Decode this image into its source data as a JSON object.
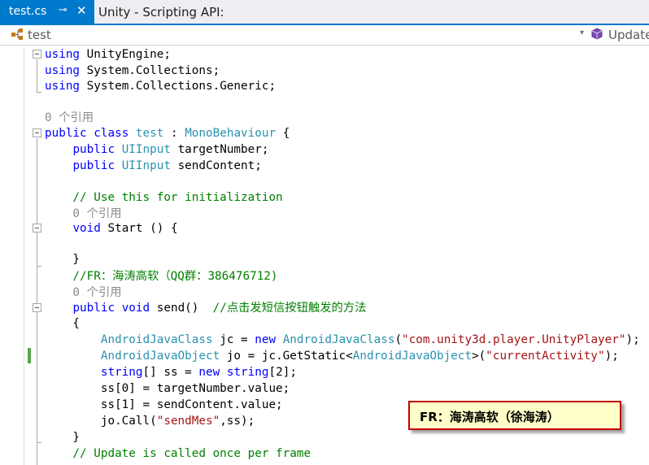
{
  "tabs": {
    "active": {
      "label": "test.cs",
      "pin_glyph": "⊸",
      "close_glyph": "✕"
    },
    "inactive": {
      "label": "Unity - Scripting API:"
    }
  },
  "navbar": {
    "left": {
      "label": "test",
      "icon": "class-icon",
      "dropdown_glyph": "▾"
    },
    "right": {
      "label": "Update",
      "icon": "method-cube-icon"
    }
  },
  "code": {
    "l1": [
      "using",
      " UnityEngine;"
    ],
    "l2": [
      "using",
      " System.Collections;"
    ],
    "l3": [
      "using",
      " System.Collections.Generic;"
    ],
    "lens1": "0 个引用",
    "l5": [
      "public",
      " ",
      "class",
      " ",
      "test",
      " : ",
      "MonoBehaviour",
      " {"
    ],
    "l6": [
      "    ",
      "public",
      " ",
      "UIInput",
      " targetNumber;"
    ],
    "l7": [
      "    ",
      "public",
      " ",
      "UIInput",
      " sendContent;"
    ],
    "l9": "    // Use this for initialization",
    "lens2": "    0 个引用",
    "l10": [
      "    ",
      "void",
      " Start () {"
    ],
    "l12": "    }",
    "l13": "    //FR：海涛高软（QQ群：386476712)",
    "lens3": "    0 个引用",
    "l14": [
      "    ",
      "public",
      " ",
      "void",
      " send()  ",
      "//点击发短信按钮触发的方法"
    ],
    "l15": "    {",
    "l16": [
      "        ",
      "AndroidJavaClass",
      " jc = ",
      "new",
      " ",
      "AndroidJavaClass",
      "(",
      "\"com.unity3d.player.UnityPlayer\"",
      ");"
    ],
    "l17": [
      "        ",
      "AndroidJavaObject",
      " jo = jc.GetStatic<",
      "AndroidJavaObject",
      ">(",
      "\"currentActivity\"",
      ");"
    ],
    "l18": [
      "        ",
      "string",
      "[] ss = ",
      "new",
      " ",
      "string",
      "[2];"
    ],
    "l19": "        ss[0] = targetNumber.value;",
    "l20": "        ss[1] = sendContent.value;",
    "l21": [
      "        jo.Call(",
      "\"sendMes\"",
      ",ss);"
    ],
    "l22": "    }",
    "l23": "    // Update is called once per frame"
  },
  "callout": {
    "text": "FR：海涛高软（徐海涛）"
  },
  "colors": {
    "tab_active_bg": "#007acc",
    "keyword": "#0000ff",
    "type": "#2b91af",
    "string": "#a31515",
    "comment": "#008000",
    "callout_border": "#c00000",
    "callout_bg": "#ffffc9"
  }
}
